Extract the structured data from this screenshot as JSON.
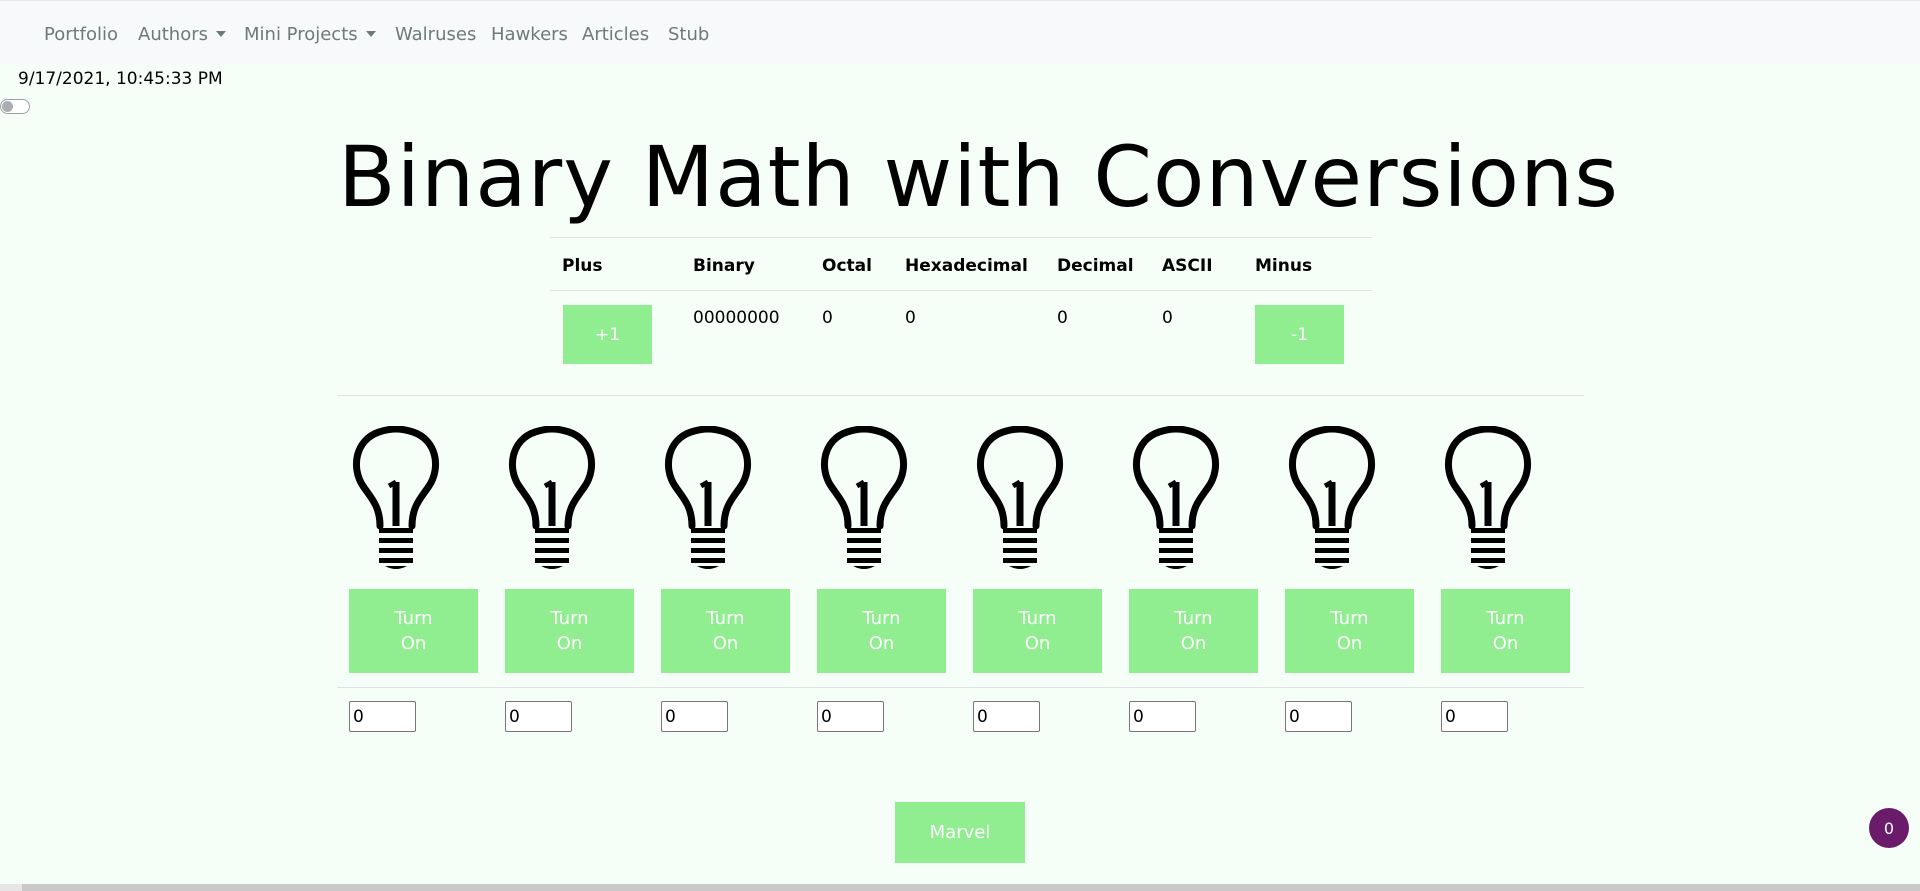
{
  "nav": {
    "items": [
      {
        "label": "Portfolio",
        "dropdown": false
      },
      {
        "label": "Authors",
        "dropdown": true
      },
      {
        "label": "Mini Projects",
        "dropdown": true
      },
      {
        "label": "Walruses",
        "dropdown": false
      },
      {
        "label": "Hawkers",
        "dropdown": false
      },
      {
        "label": "Articles",
        "dropdown": false
      },
      {
        "label": "Stub",
        "dropdown": false
      }
    ]
  },
  "datetime": "9/17/2021, 10:45:33 PM",
  "title": "Binary Math with Conversions",
  "conversions": {
    "headers": {
      "plus": "Plus",
      "binary": "Binary",
      "octal": "Octal",
      "hexadecimal": "Hexadecimal",
      "decimal": "Decimal",
      "ascii": "ASCII",
      "minus": "Minus"
    },
    "values": {
      "binary": "00000000",
      "octal": "0",
      "hexadecimal": "0",
      "decimal": "0",
      "ascii": "0"
    },
    "plus_button": "+1",
    "minus_button": "-1"
  },
  "bits": [
    {
      "button_line1": "Turn",
      "button_line2": "On",
      "value": "0"
    },
    {
      "button_line1": "Turn",
      "button_line2": "On",
      "value": "0"
    },
    {
      "button_line1": "Turn",
      "button_line2": "On",
      "value": "0"
    },
    {
      "button_line1": "Turn",
      "button_line2": "On",
      "value": "0"
    },
    {
      "button_line1": "Turn",
      "button_line2": "On",
      "value": "0"
    },
    {
      "button_line1": "Turn",
      "button_line2": "On",
      "value": "0"
    },
    {
      "button_line1": "Turn",
      "button_line2": "On",
      "value": "0"
    },
    {
      "button_line1": "Turn",
      "button_line2": "On",
      "value": "0"
    }
  ],
  "marvel_button": "Marvel",
  "badge_count": "0",
  "colors": {
    "button_bg": "#90ee90",
    "page_bg": "#f5fff8",
    "badge_bg": "#6a1b6a"
  },
  "icons": {
    "bulb": "lightbulb-off-icon",
    "dropdown": "caret-down-icon"
  }
}
